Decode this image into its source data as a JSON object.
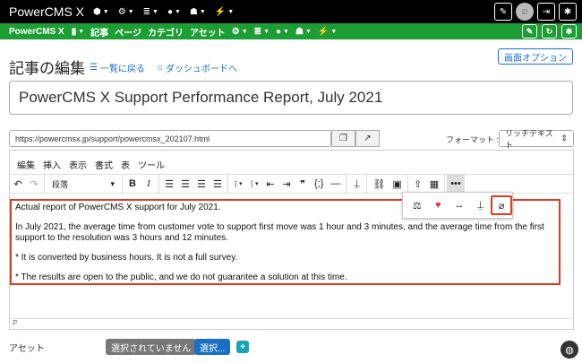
{
  "topbar": {
    "brand": "PowerCMS X",
    "icons": [
      "cube-icon",
      "gear-icon",
      "database-icon",
      "comments-icon",
      "users-icon",
      "plug-icon"
    ],
    "right_icons": [
      "edit-icon",
      "avatar",
      "sign-out-icon",
      "wrench-icon"
    ]
  },
  "greenbar": {
    "site": "PowerCMS X",
    "bookmark_icon": "bookmark-icon",
    "items": [
      "記事",
      "ページ",
      "カテゴリ",
      "アセット"
    ],
    "icons": [
      "gear-icon",
      "database-icon",
      "comments-icon",
      "users-icon",
      "plug-icon"
    ],
    "right_icons": [
      "edit-icon",
      "refresh-icon",
      "wrench-icon"
    ]
  },
  "header": {
    "title": "記事の編集",
    "back_link": "一覧に戻る",
    "dashboard_link": "ダッシュボードへ",
    "screen_options": "画面オプション"
  },
  "entry": {
    "title": "PowerCMS X Support Performance Report, July 2021",
    "url": "https://powercmsx.jp/support/powercmsx_202107.html",
    "format_label": "フォーマット :",
    "format_value": "リッチテキスト"
  },
  "editor": {
    "menu": [
      "編集",
      "挿入",
      "表示",
      "書式",
      "表",
      "ツール"
    ],
    "block_format": "段落",
    "paragraphs": [
      "Actual report of PowerCMS X support for July 2021.",
      "In July 2021, the average time from customer vote to support first move was 1 hour and 3 minutes, and the average time from the first support to the resolution was 3 hours and 12 minutes.",
      "* It is converted by business hours. It is not a full survey.",
      "* The results are open to the public, and we do not guarantee a solution at this time."
    ],
    "path": "P",
    "highlight_color": "#e03a1e"
  },
  "assets": {
    "label": "アセット",
    "none_badge": "選択されていません",
    "select_button": "選択...",
    "add_button": "+"
  },
  "colors": {
    "topbar": "#000000",
    "greenbar": "#1d9e34",
    "link": "#1a6fc4",
    "highlight": "#e03a1e"
  }
}
